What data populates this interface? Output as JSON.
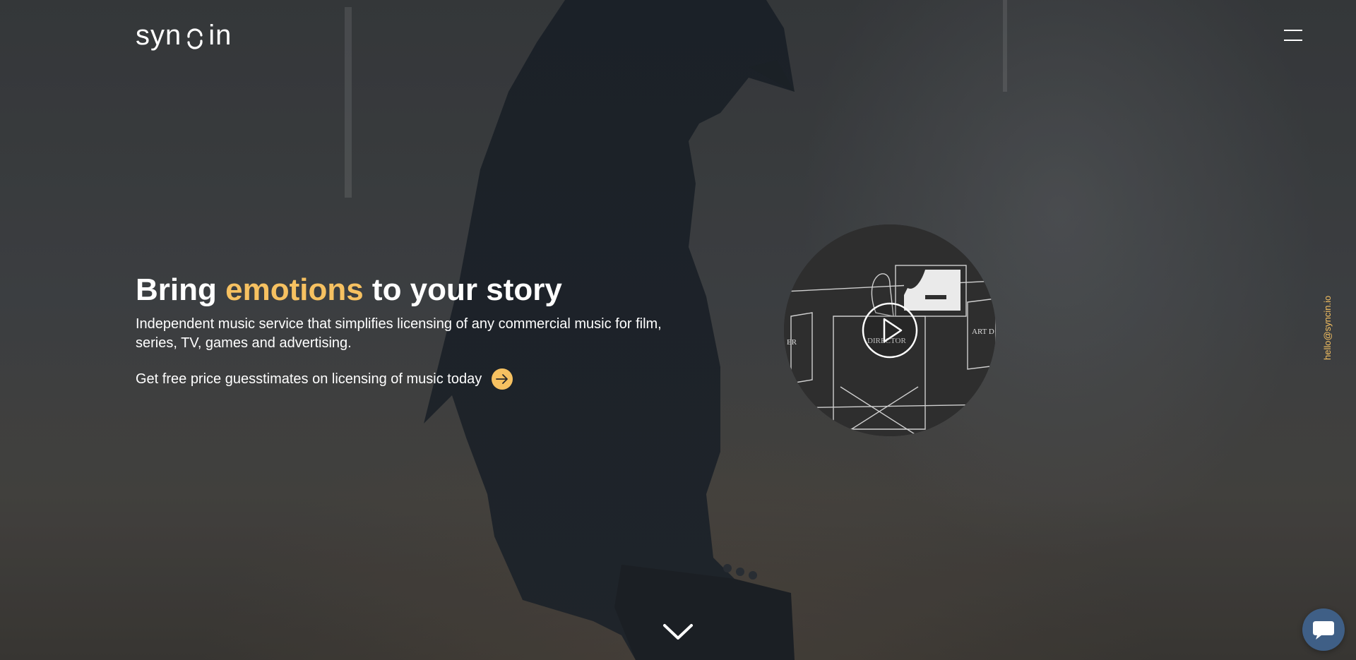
{
  "brand": {
    "logo_left": "syn",
    "logo_right": "in"
  },
  "hero": {
    "headline_part1": "Bring ",
    "headline_accent": "emotions",
    "headline_part2": " to your story",
    "subtitle": "Independent music service that simplifies licensing of any commercial music for film, series, TV, games and advertising.",
    "cta_label": "Get free price guesstimates on licensing of music today"
  },
  "video": {
    "sign_left": "ER",
    "sign_center": "DIRECTOR",
    "sign_right": "ART D"
  },
  "contact": {
    "email": "hello@syncin.io"
  },
  "colors": {
    "accent": "#f6c161",
    "chat": "#3f5f86"
  },
  "icons": {
    "menu": "hamburger-icon",
    "play": "play-icon",
    "arrow": "arrow-right-icon",
    "scroll": "chevron-down-icon",
    "chat": "chat-bubble-icon"
  }
}
